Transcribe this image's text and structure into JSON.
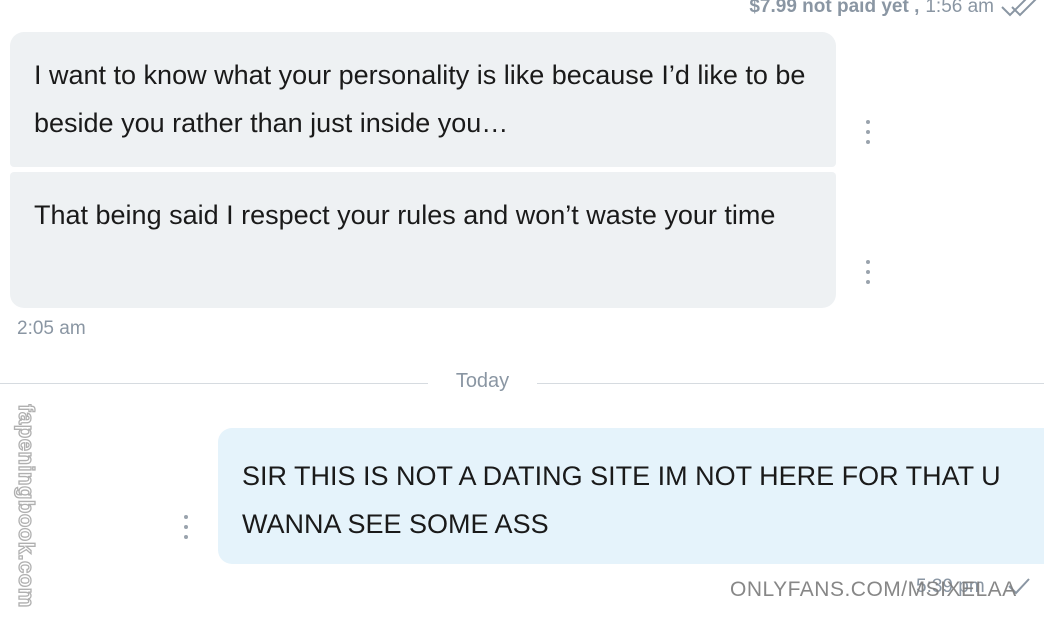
{
  "top_status": {
    "price_text": "$7.99 not paid yet ,",
    "time": "1:56 am",
    "read_icon": "double-check-icon"
  },
  "messages_received": [
    {
      "text": "I want to know what your personality is like because I’d like to be beside you rather than just inside you…"
    },
    {
      "text": "That being said I respect your rules and won’t waste your time"
    }
  ],
  "received_time": "2:05 am",
  "date_divider": "Today",
  "message_sent": {
    "text": "SIR THIS IS NOT A DATING SITE IM NOT HERE FOR THAT U WANNA SEE SOME ASS",
    "time": "5:39 pm",
    "status_icon": "check-icon"
  },
  "watermark_text": "ONLYFANS.COM/MSIXELAA",
  "side_watermark_text": "fapeningbook.com",
  "colors": {
    "received_bubble": "#eef1f3",
    "sent_bubble": "#e5f3fb",
    "meta_text": "#8a96a3"
  }
}
